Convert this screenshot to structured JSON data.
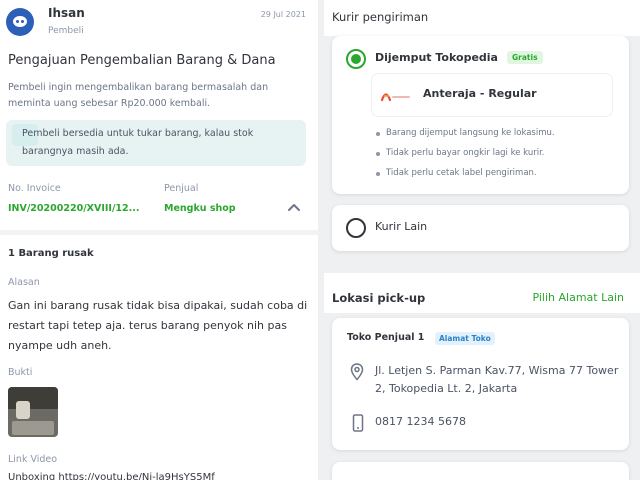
{
  "buyer": {
    "name": "Ihsan",
    "role": "Pembeli",
    "date": "29 Jul 2021"
  },
  "request": {
    "title": "Pengajuan Pengembalian Barang & Dana",
    "description": "Pembeli ingin mengembalikan barang bermasalah dan meminta uang sebesar Rp20.000 kembali.",
    "note": "Pembeli bersedia untuk tukar barang, kalau stok barangnya masih ada."
  },
  "invoice": {
    "label": "No. Invoice",
    "value": "INV/20200220/XVIII/12...",
    "seller_label": "Penjual",
    "seller_value": "Mengku shop"
  },
  "items": {
    "heading": "1 Barang rusak",
    "reason_label": "Alasan",
    "reason_text": "Gan ini barang rusak tidak bisa dipakai, sudah coba di restart tapi tetep aja. terus barang penyok nih pas nyampe udh aneh.",
    "proof_label": "Bukti",
    "video_label": "Link Video",
    "video_link": "Unboxing https://youtu.be/Nj-la9HsYS5Mf"
  },
  "courier": {
    "title": "Kurir pengiriman",
    "pickup_option": "Dijemput Tokopedia",
    "free_badge": "Gratis",
    "service_name": "Anteraja - Regular",
    "bullets": [
      "Barang dijemput langsung ke lokasimu.",
      "Tidak perlu bayar ongkir lagi ke kurir.",
      "Tidak perlu cetak label pengiriman."
    ],
    "other_option": "Kurir Lain"
  },
  "pickup_location": {
    "title": "Lokasi pick-up",
    "change_link": "Pilih Alamat Lain",
    "store_name": "Toko Penjual 1",
    "store_badge": "Alamat Toko",
    "address": "Jl. Letjen S. Parman Kav.77, Wisma 77 Tower 2, Tokopedia Lt. 2, Jakarta",
    "phone": "0817 1234 5678"
  },
  "colors": {
    "accent_green": "#2aa72e",
    "badge_blue": "#2b82c9",
    "text_dark": "#31353b",
    "text_muted": "#8d96aa"
  }
}
